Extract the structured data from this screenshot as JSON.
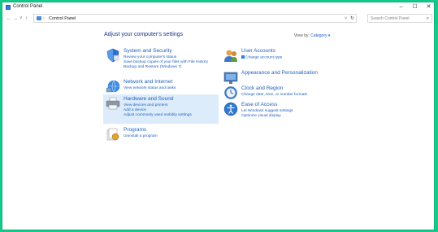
{
  "window": {
    "title": "Control Panel",
    "controls": {
      "minimize": "–",
      "maximize": "☐",
      "close": "✕"
    }
  },
  "nav": {
    "back": "←",
    "forward": "→",
    "recent": "˅",
    "up": "↑"
  },
  "address": {
    "separator": "›",
    "crumb": "Control Panel",
    "dropdown": "˅",
    "refresh": "↻"
  },
  "search": {
    "placeholder": "Search Control Panel",
    "icon": "⌕"
  },
  "main": {
    "heading": "Adjust your computer's settings",
    "view_by_label": "View by:",
    "view_by_value": "Category ▾"
  },
  "categories": [
    {
      "title": "System and Security",
      "icon": "shield-icon",
      "links": [
        "Review your computer's status",
        "Save backup copies of your files with File History",
        "Backup and Restore (Windows 7)"
      ]
    },
    {
      "title": "Network and Internet",
      "icon": "network-icon",
      "links": [
        "View network status and tasks"
      ]
    },
    {
      "title": "Hardware and Sound",
      "icon": "printer-icon",
      "links": [
        "View devices and printers",
        "Add a device",
        "Adjust commonly used mobility settings"
      ]
    },
    {
      "title": "Programs",
      "icon": "programs-icon",
      "links": [
        "Uninstall a program"
      ]
    },
    {
      "title": "User Accounts",
      "icon": "users-icon",
      "links": [
        "Change account type"
      ]
    },
    {
      "title": "Appearance and Personalization",
      "icon": "appearance-icon",
      "links": []
    },
    {
      "title": "Clock and Region",
      "icon": "clock-icon",
      "links": [
        "Change date, time, or number formats"
      ]
    },
    {
      "title": "Ease of Access",
      "icon": "ease-of-access-icon",
      "links": [
        "Let Windows suggest settings",
        "Optimize visual display"
      ]
    }
  ],
  "colors": {
    "accent": "#1e5fbf",
    "heading": "#1e3287",
    "highlight": "#dcecfb",
    "frame": "#14c98a"
  }
}
